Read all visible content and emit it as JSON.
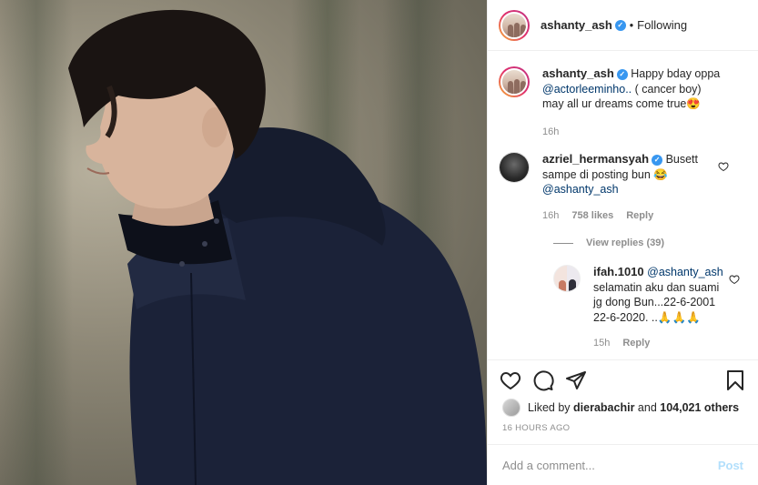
{
  "header": {
    "username": "ashanty_ash",
    "separator": "•",
    "follow_status": "Following"
  },
  "caption": {
    "username": "ashanty_ash",
    "text": "Happy bday oppa @actorleeminho.. ( cancer boy) may all ur dreams come true😍",
    "time": "16h"
  },
  "comments": [
    {
      "username": "azriel_hermansyah",
      "text": "Busett sampe di posting bun 😂 @ashanty_ash",
      "time": "16h",
      "likes": "758 likes",
      "reply_label": "Reply",
      "view_replies": "View replies (39)"
    }
  ],
  "reply": {
    "username": "ifah.1010",
    "text": "@ashanty_ash selamatin aku dan suami jg dong Bun...22-6-2001 22-6-2020. ..🙏🙏🙏",
    "time": "15h",
    "reply_label": "Reply"
  },
  "actions": {
    "icons": [
      "heart-icon",
      "comment-icon",
      "share-icon",
      "bookmark-icon"
    ]
  },
  "likes": {
    "prefix": "Liked by",
    "user": "dierabachir",
    "middle": "and",
    "count": "104,021 others"
  },
  "timestamp": "16 HOURS AGO",
  "add_comment": {
    "placeholder": "Add a comment...",
    "post_label": "Post"
  },
  "colors": {
    "link": "#00376b",
    "verified": "#3897f0",
    "secondary": "#8e8e8e",
    "post_disabled": "#b2dffc"
  }
}
